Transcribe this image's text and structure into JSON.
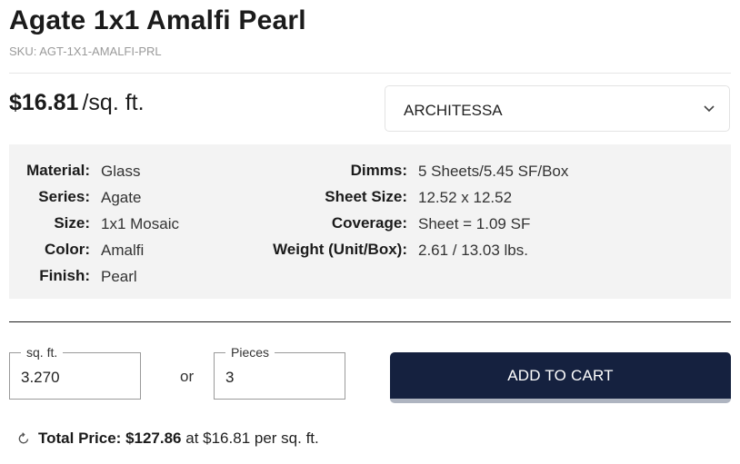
{
  "product": {
    "title": "Agate 1x1 Amalfi Pearl",
    "sku": "SKU: AGT-1X1-AMALFI-PRL",
    "price": "$16.81",
    "price_unit": "/sq. ft."
  },
  "brand_select": {
    "value": "ARCHITESSA",
    "icon": "chevron-down-icon"
  },
  "specs": {
    "left": [
      {
        "label": "Material:",
        "value": "Glass"
      },
      {
        "label": "Series:",
        "value": "Agate"
      },
      {
        "label": "Size:",
        "value": "1x1 Mosaic"
      },
      {
        "label": "Color:",
        "value": "Amalfi"
      },
      {
        "label": "Finish:",
        "value": "Pearl"
      }
    ],
    "right": [
      {
        "label": "Dimms:",
        "value": "5 Sheets/5.45 SF/Box"
      },
      {
        "label": "Sheet Size:",
        "value": "12.52 x 12.52"
      },
      {
        "label": "Coverage:",
        "value": "Sheet = 1.09 SF"
      },
      {
        "label": "Weight (Unit/Box):",
        "value": "2.61 / 13.03 lbs."
      }
    ]
  },
  "quantity": {
    "sqft_label": "sq. ft.",
    "sqft_value": "3.270",
    "or_label": "or",
    "pieces_label": "Pieces",
    "pieces_value": "3"
  },
  "cart": {
    "button_label": "ADD TO CART",
    "color": "#15213f"
  },
  "total": {
    "label": "Total Price:",
    "amount": "$127.86",
    "at_text": "at $16.81 per sq. ft.",
    "icon": "refresh-icon"
  }
}
